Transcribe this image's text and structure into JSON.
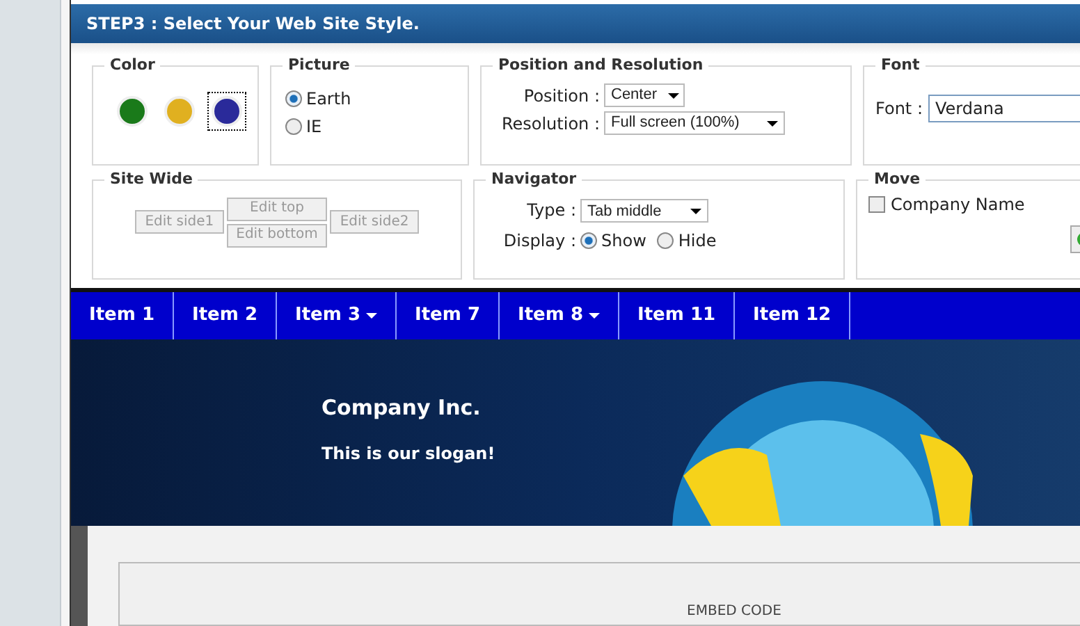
{
  "header": {
    "title": "STEP3 : Select Your Web Site Style."
  },
  "color": {
    "legend": "Color",
    "swatches": [
      {
        "color": "#1a7a1a",
        "selected": false
      },
      {
        "color": "#e0b020",
        "selected": false
      },
      {
        "color": "#2a2a9a",
        "selected": true
      }
    ]
  },
  "picture": {
    "legend": "Picture",
    "options": [
      {
        "label": "Earth",
        "selected": true
      },
      {
        "label": "IE",
        "selected": false
      }
    ]
  },
  "position": {
    "legend": "Position and Resolution",
    "fields": [
      {
        "label": "Position :",
        "value": "Center"
      },
      {
        "label": "Resolution :",
        "value": "Full screen (100%)"
      }
    ]
  },
  "font": {
    "legend": "Font",
    "label": "Font :",
    "value": "Verdana"
  },
  "site_wide": {
    "legend": "Site Wide",
    "buttons": [
      "Edit side1",
      "Edit top",
      "Edit bottom",
      "Edit side2"
    ]
  },
  "navigator": {
    "legend": "Navigator",
    "type_label": "Type :",
    "type_value": "Tab middle",
    "display_label": "Display :",
    "display_options": [
      {
        "label": "Show",
        "selected": true
      },
      {
        "label": "Hide",
        "selected": false
      }
    ]
  },
  "move": {
    "legend": "Move",
    "checkbox": {
      "label": "Company Name",
      "checked": false
    }
  },
  "nav": [
    {
      "label": "Item 1",
      "dropdown": false
    },
    {
      "label": "Item 2",
      "dropdown": false
    },
    {
      "label": "Item 3",
      "dropdown": true
    },
    {
      "label": "Item 7",
      "dropdown": false
    },
    {
      "label": "Item 8",
      "dropdown": true
    },
    {
      "label": "Item 11",
      "dropdown": false
    },
    {
      "label": "Item 12",
      "dropdown": false
    }
  ],
  "banner": {
    "company": "Company Inc.",
    "slogan": "This is our slogan!"
  },
  "embed": {
    "label": "EMBED CODE"
  }
}
